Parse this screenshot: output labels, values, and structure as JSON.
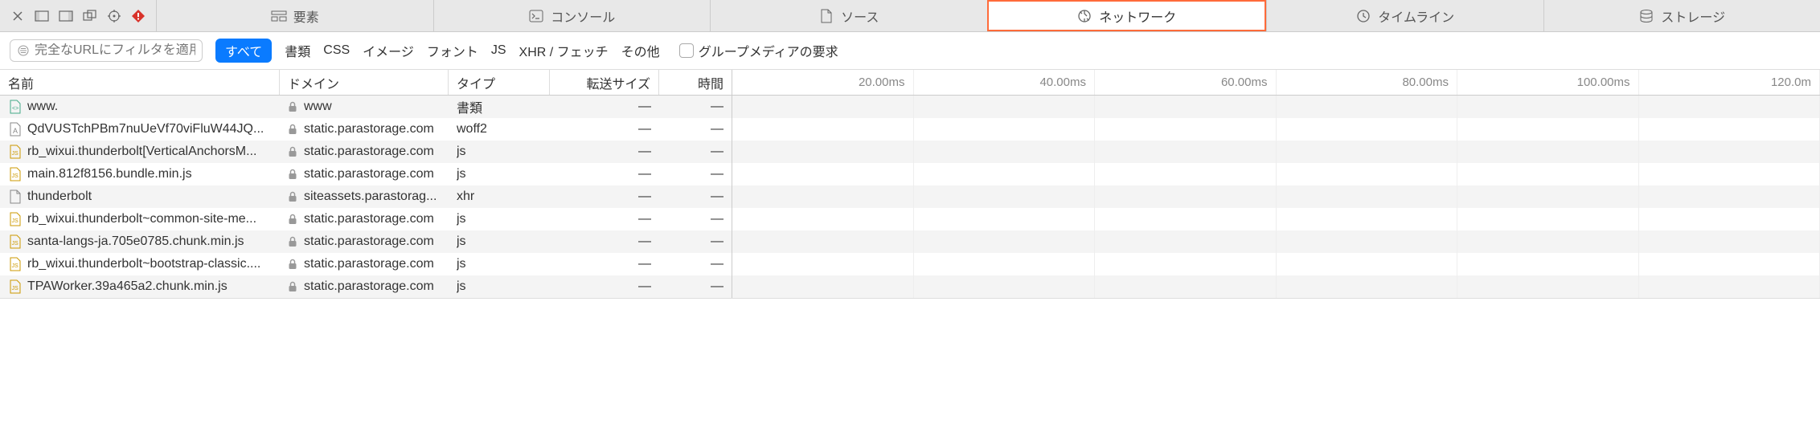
{
  "tabs": {
    "icons": [
      "close",
      "square",
      "split",
      "copy",
      "target",
      "error"
    ],
    "items": [
      {
        "label": "要素",
        "icon": "elements"
      },
      {
        "label": "コンソール",
        "icon": "console"
      },
      {
        "label": "ソース",
        "icon": "source"
      },
      {
        "label": "ネットワーク",
        "icon": "network",
        "active": true
      },
      {
        "label": "タイムライン",
        "icon": "timeline"
      },
      {
        "label": "ストレージ",
        "icon": "storage"
      }
    ]
  },
  "filter": {
    "placeholder": "完全なURLにフィルタを適用",
    "all": "すべて",
    "items": [
      "書類",
      "CSS",
      "イメージ",
      "フォント",
      "JS",
      "XHR / フェッチ",
      "その他"
    ],
    "group_media": "グループメディアの要求"
  },
  "columns": {
    "name": "名前",
    "domain": "ドメイン",
    "type": "タイプ",
    "size": "転送サイズ",
    "time": "時間"
  },
  "timeline_headers": [
    "20.00ms",
    "40.00ms",
    "60.00ms",
    "80.00ms",
    "100.00ms",
    "120.0m"
  ],
  "rows": [
    {
      "icon": "html",
      "name": "www.",
      "domain": "www",
      "type": "書類",
      "size": "—",
      "time": "—"
    },
    {
      "icon": "font",
      "name": "QdVUSTchPBm7nuUeVf70viFluW44JQ...",
      "domain": "static.parastorage.com",
      "type": "woff2",
      "size": "—",
      "time": "—"
    },
    {
      "icon": "js",
      "name": "rb_wixui.thunderbolt[VerticalAnchorsM...",
      "domain": "static.parastorage.com",
      "type": "js",
      "size": "—",
      "time": "—"
    },
    {
      "icon": "js",
      "name": "main.812f8156.bundle.min.js",
      "domain": "static.parastorage.com",
      "type": "js",
      "size": "—",
      "time": "—"
    },
    {
      "icon": "file",
      "name": "thunderbolt",
      "domain": "siteassets.parastorag...",
      "type": "xhr",
      "size": "—",
      "time": "—"
    },
    {
      "icon": "js",
      "name": "rb_wixui.thunderbolt~common-site-me...",
      "domain": "static.parastorage.com",
      "type": "js",
      "size": "—",
      "time": "—"
    },
    {
      "icon": "js",
      "name": "santa-langs-ja.705e0785.chunk.min.js",
      "domain": "static.parastorage.com",
      "type": "js",
      "size": "—",
      "time": "—"
    },
    {
      "icon": "js",
      "name": "rb_wixui.thunderbolt~bootstrap-classic....",
      "domain": "static.parastorage.com",
      "type": "js",
      "size": "—",
      "time": "—"
    },
    {
      "icon": "js",
      "name": "TPAWorker.39a465a2.chunk.min.js",
      "domain": "static.parastorage.com",
      "type": "js",
      "size": "—",
      "time": "—"
    }
  ]
}
